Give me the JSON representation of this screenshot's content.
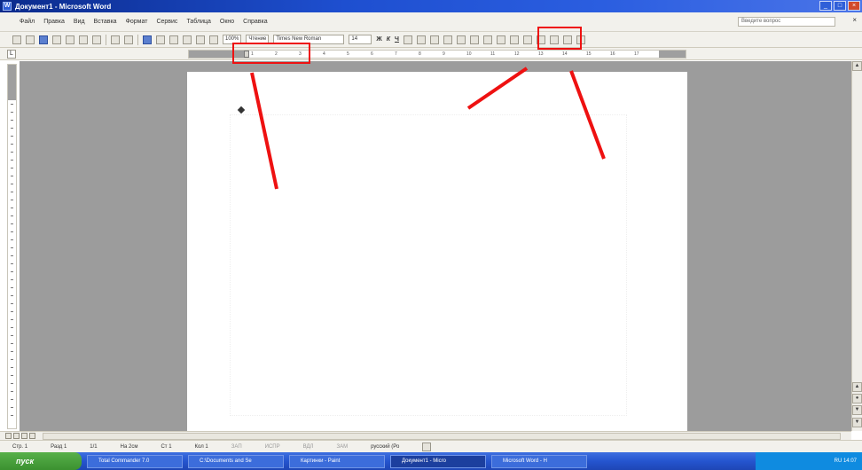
{
  "window": {
    "title": "Документ1 - Microsoft Word",
    "buttons": [
      "_",
      "□",
      "×"
    ]
  },
  "menubar": {
    "items": [
      "Файл",
      "Правка",
      "Вид",
      "Вставка",
      "Формат",
      "Сервис",
      "Таблица",
      "Окно",
      "Справка"
    ],
    "help_placeholder": "Введите вопрос",
    "close_doc": "×"
  },
  "toolbar": {
    "zoom": "100%",
    "read_mode": "Чтение",
    "font_name": "Times New Roman",
    "font_size": "14",
    "bold": "Ж",
    "italic": "К",
    "underline": "Ч"
  },
  "ruler": {
    "corner": "L",
    "ticks": [
      "1",
      "2",
      "3",
      "4",
      "5",
      "6",
      "7",
      "8",
      "9",
      "10",
      "11",
      "12",
      "13",
      "14",
      "15",
      "16",
      "17"
    ]
  },
  "statusbar": {
    "page": "Стр. 1",
    "section": "Разд 1",
    "page_of": "1/1",
    "position": "На 2см",
    "line": "Ст 1",
    "column": "Кол 1",
    "rec": "ЗАП",
    "trk": "ИСПР",
    "ext": "ВДЛ",
    "ovr": "ЗАМ",
    "lang": "русский (Ро"
  },
  "taskbar": {
    "start": "пуск",
    "tasks": [
      "Total Commander 7.0",
      "C:\\Documents and Se",
      "Картинки - Paint",
      "Документ1 - Micro",
      "Microsoft Word - Н"
    ],
    "clock": "RU  14:07"
  },
  "colors": {
    "annotation": "#ee1111",
    "workspace": "#9c9c9c"
  }
}
